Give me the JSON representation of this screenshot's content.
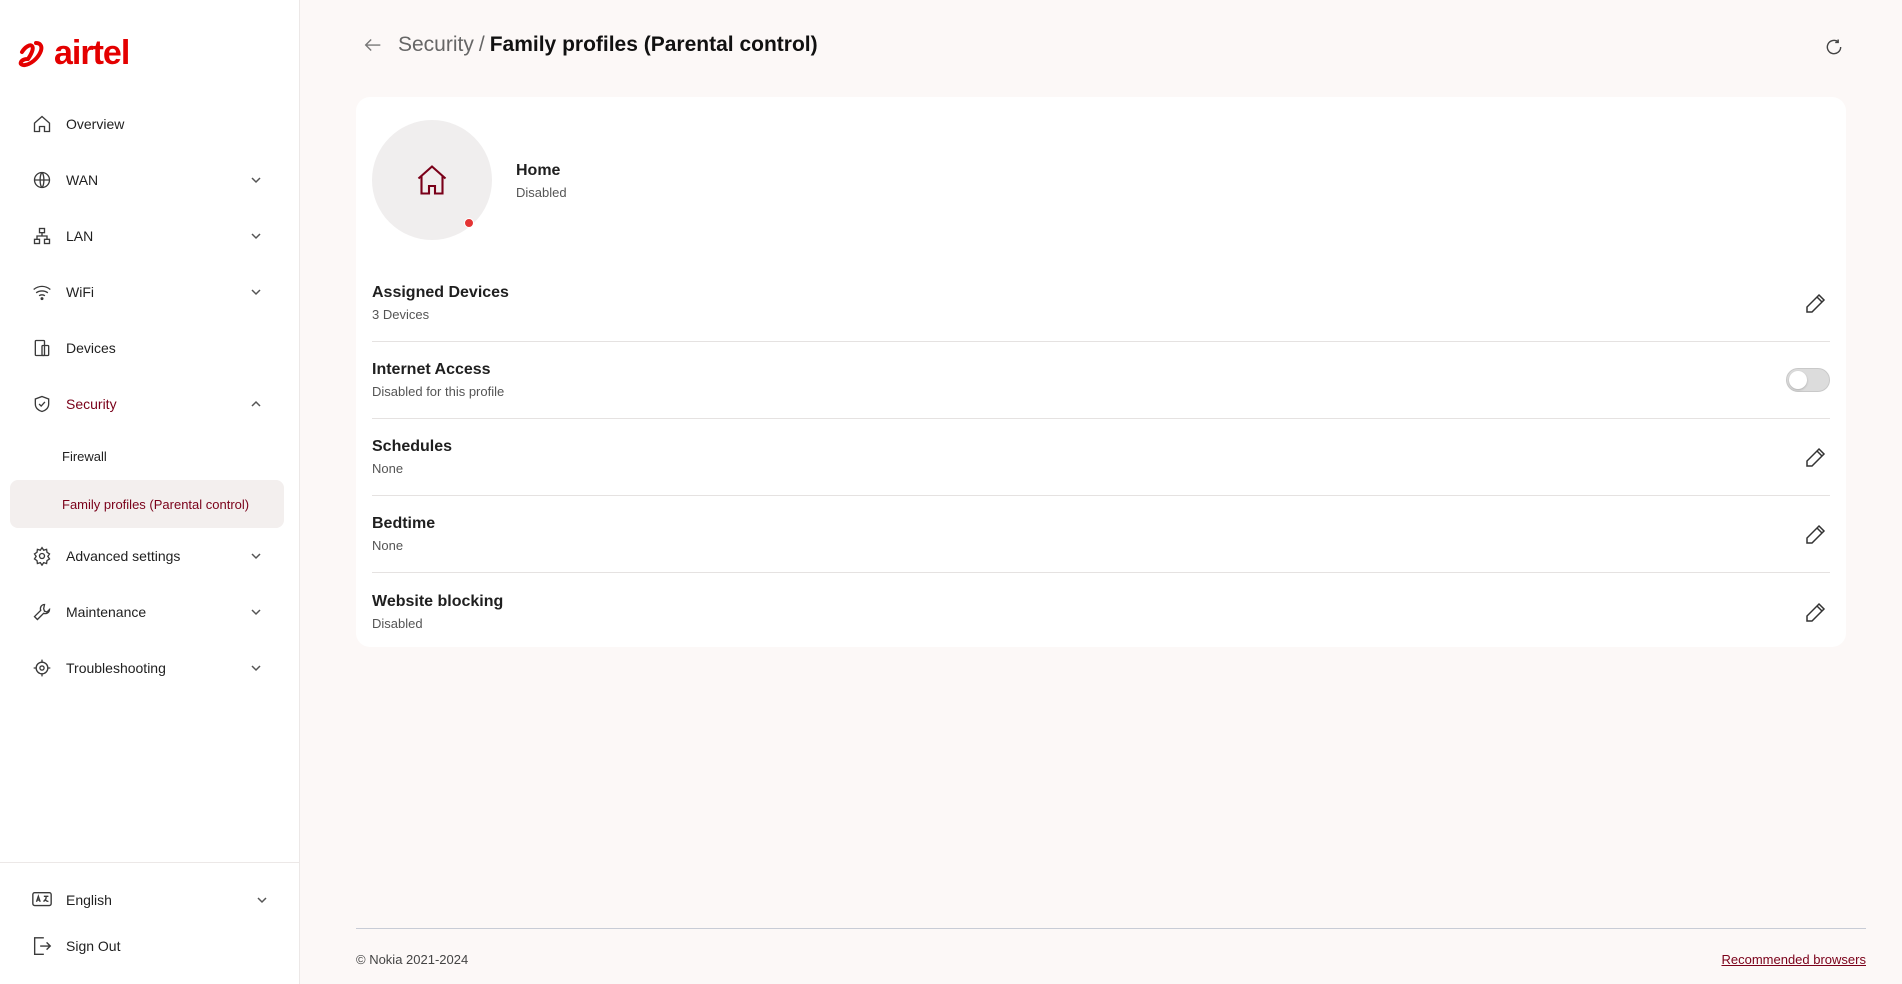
{
  "brand": {
    "name": "airtel",
    "color": "#e40000"
  },
  "sidebar": {
    "items": [
      {
        "label": "Overview",
        "icon": "home-icon",
        "expandable": false
      },
      {
        "label": "WAN",
        "icon": "globe-icon",
        "expandable": true
      },
      {
        "label": "LAN",
        "icon": "network-icon",
        "expandable": true
      },
      {
        "label": "WiFi",
        "icon": "wifi-icon",
        "expandable": true
      },
      {
        "label": "Devices",
        "icon": "devices-icon",
        "expandable": false
      },
      {
        "label": "Security",
        "icon": "shield-icon",
        "expandable": true,
        "expanded": true,
        "active": true
      },
      {
        "label": "Advanced settings",
        "icon": "gear-icon",
        "expandable": true
      },
      {
        "label": "Maintenance",
        "icon": "wrench-icon",
        "expandable": true
      },
      {
        "label": "Troubleshooting",
        "icon": "target-icon",
        "expandable": true
      }
    ],
    "security_sub": [
      {
        "label": "Firewall",
        "selected": false
      },
      {
        "label": "Family profiles (Parental control)",
        "selected": true
      }
    ],
    "language": "English",
    "sign_out": "Sign Out"
  },
  "header": {
    "parent": "Security",
    "separator": "/",
    "current": "Family profiles (Parental control)"
  },
  "profile": {
    "name": "Home",
    "status": "Disabled",
    "status_color": "#e43434"
  },
  "rows": [
    {
      "title": "Assigned Devices",
      "sub": "3 Devices",
      "control": "edit"
    },
    {
      "title": "Internet Access",
      "sub": "Disabled for this profile",
      "control": "toggle",
      "on": false
    },
    {
      "title": "Schedules",
      "sub": "None",
      "control": "edit"
    },
    {
      "title": "Bedtime",
      "sub": "None",
      "control": "edit"
    },
    {
      "title": "Website blocking",
      "sub": "Disabled",
      "control": "edit"
    }
  ],
  "footer": {
    "copyright": "© Nokia 2021-2024",
    "link": "Recommended browsers"
  },
  "colors": {
    "accent": "#7a0019",
    "background": "#fcf8f7"
  }
}
